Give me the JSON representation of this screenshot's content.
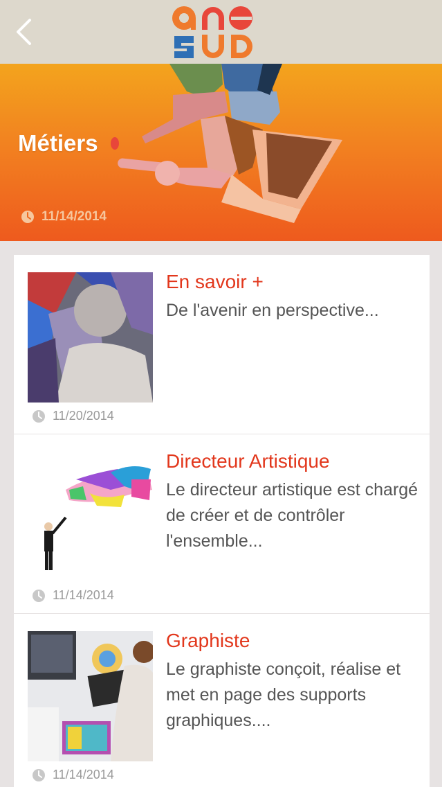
{
  "header": {
    "back_icon": "chevron-left-icon",
    "logo_text_top": "ANE",
    "logo_text_bottom": "SUD"
  },
  "hero": {
    "title": "Métiers",
    "date": "11/14/2014",
    "date_icon": "clock-icon"
  },
  "articles": [
    {
      "title": "En savoir +",
      "description": "De l'avenir en perspective...",
      "date": "11/20/2014"
    },
    {
      "title": "Directeur Artistique",
      "description": "Le directeur artistique est chargé de créer et de contrôler l'ensemble...",
      "date": "11/14/2014"
    },
    {
      "title": "Graphiste",
      "description": "Le graphiste conçoit, réalise et met en page des supports graphiques....",
      "date": "11/14/2014"
    }
  ],
  "colors": {
    "accent": "#e2371c",
    "hero_top": "#f3a41d",
    "hero_bottom": "#ee5a1e",
    "topbar": "#ddd8cc"
  }
}
